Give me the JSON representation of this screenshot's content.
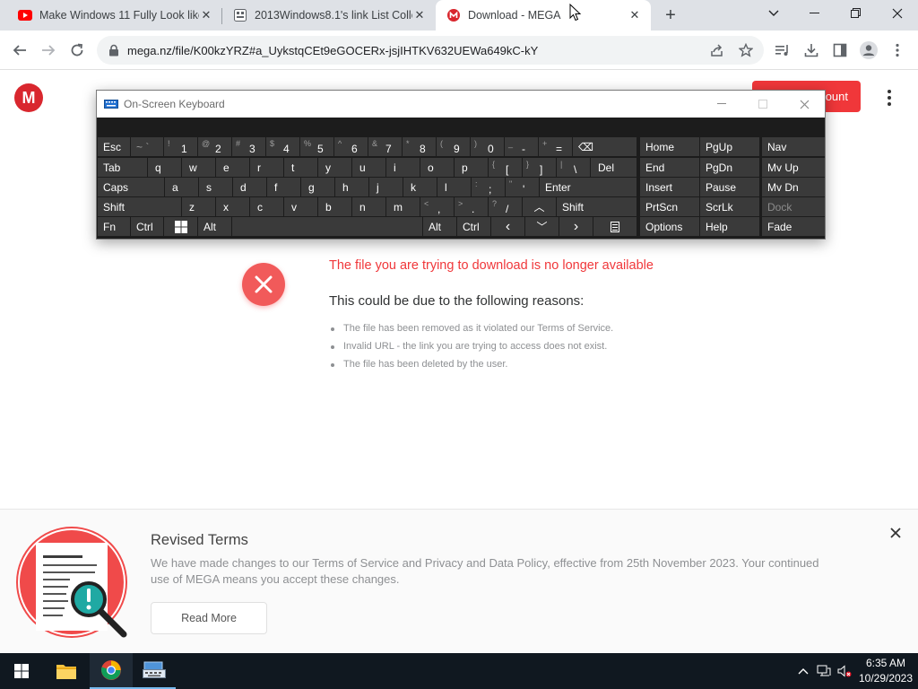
{
  "browser": {
    "tabs": [
      {
        "title": "Make Windows 11 Fully Look like",
        "icon": "youtube-icon",
        "active": false
      },
      {
        "title": "2013Windows8.1's link List Colle",
        "icon": "site-icon",
        "active": false
      },
      {
        "title": "Download - MEGA",
        "icon": "mega-icon",
        "active": true
      }
    ],
    "new_tab_label": "+",
    "url": "mega.nz/file/K00kzYRZ#a_UykstqCEt9eGOCERx-jsjIHTKV632UEWa649kC-kY"
  },
  "mega": {
    "logo_letter": "M",
    "create_account_label": "ount",
    "error_title": "The file you are trying to download is no longer available",
    "reasons_title": "This could be due to the following reasons:",
    "reasons": [
      "The file has been removed as it violated our Terms of Service.",
      "Invalid URL - the link you are trying to access does not exist.",
      "The file has been deleted by the user."
    ],
    "colors": {
      "brand_red": "#d9272e",
      "error_red": "#f0373a"
    }
  },
  "terms_banner": {
    "title": "Revised Terms",
    "text": "We have made changes to our Terms of Service and Privacy and Data Policy, effective from 25th November 2023. Your continued use of MEGA means you accept these changes.",
    "read_more_label": "Read More"
  },
  "osk": {
    "title": "On-Screen Keyboard",
    "keys": {
      "esc": "Esc",
      "tilde_shift": "~ `",
      "n1_shift": "!",
      "n1": "1",
      "n2_shift": "@",
      "n2": "2",
      "n3_shift": "#",
      "n3": "3",
      "n4_shift": "$",
      "n4": "4",
      "n5_shift": "%",
      "n5": "5",
      "n6_shift": "^",
      "n6": "6",
      "n7_shift": "&",
      "n7": "7",
      "n8_shift": "*",
      "n8": "8",
      "n9_shift": "(",
      "n9": "9",
      "n0_shift": ")",
      "n0": "0",
      "minus_shift": "_",
      "minus": "-",
      "plus_shift": "+",
      "plus": "=",
      "backspace": "⌫",
      "tab": "Tab",
      "q": "q",
      "w": "w",
      "e": "e",
      "r": "r",
      "t": "t",
      "y": "y",
      "u": "u",
      "i": "i",
      "o": "o",
      "p": "p",
      "lbrace_shift": "{",
      "lbrace": "[",
      "rbrace_shift": "}",
      "rbrace": "]",
      "pipe_shift": "|",
      "pipe": "\\",
      "del": "Del",
      "caps": "Caps",
      "a": "a",
      "s": "s",
      "d": "d",
      "f": "f",
      "g": "g",
      "h": "h",
      "j": "j",
      "k": "k",
      "l": "l",
      "colon_shift": ":",
      "colon": ";",
      "quote_shift": "\"",
      "quote": "'",
      "enter": "Enter",
      "shift_l": "Shift",
      "z": "z",
      "x": "x",
      "c": "c",
      "v": "v",
      "b": "b",
      "n": "n",
      "m": "m",
      "comma_shift": "<",
      "comma": ",",
      "period_shift": ">",
      "period": ".",
      "slash_shift": "?",
      "slash": "/",
      "up": "︿",
      "shift_r": "Shift",
      "fn": "Fn",
      "ctrl_l": "Ctrl",
      "alt_l": "Alt",
      "alt_r": "Alt",
      "ctrl_r": "Ctrl",
      "left": "‹",
      "down": "﹀",
      "right": "›",
      "home": "Home",
      "pgup": "PgUp",
      "nav": "Nav",
      "end": "End",
      "pgdn": "PgDn",
      "mvup": "Mv Up",
      "insert": "Insert",
      "pause": "Pause",
      "mvdn": "Mv Dn",
      "prtscn": "PrtScn",
      "scrlk": "ScrLk",
      "dock": "Dock",
      "options": "Options",
      "help": "Help",
      "fade": "Fade"
    }
  },
  "taskbar": {
    "time": "6:35 AM",
    "date": "10/29/2023"
  }
}
